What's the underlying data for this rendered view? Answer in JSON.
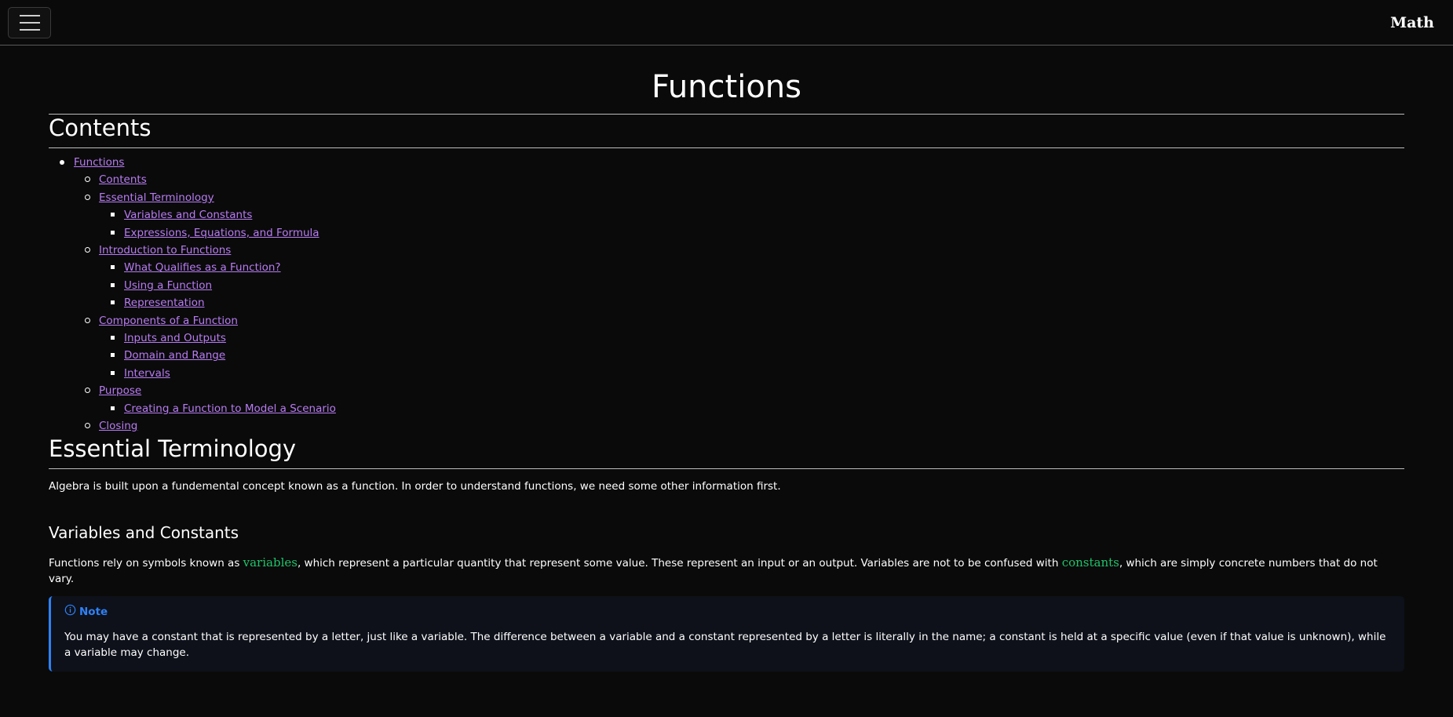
{
  "navbar": {
    "brand": "Math"
  },
  "page": {
    "title": "Functions"
  },
  "contents": {
    "heading": "Contents",
    "items": [
      {
        "label": "Functions",
        "children": [
          {
            "label": "Contents",
            "children": []
          },
          {
            "label": "Essential Terminology",
            "children": [
              {
                "label": "Variables and Constants"
              },
              {
                "label": "Expressions, Equations, and Formula"
              }
            ]
          },
          {
            "label": "Introduction to Functions",
            "children": [
              {
                "label": "What Qualifies as a Function?"
              },
              {
                "label": "Using a Function"
              },
              {
                "label": "Representation"
              }
            ]
          },
          {
            "label": "Components of a Function",
            "children": [
              {
                "label": "Inputs and Outputs"
              },
              {
                "label": "Domain and Range"
              },
              {
                "label": "Intervals"
              }
            ]
          },
          {
            "label": "Purpose",
            "children": [
              {
                "label": "Creating a Function to Model a Scenario"
              }
            ]
          },
          {
            "label": "Closing",
            "children": []
          }
        ]
      }
    ]
  },
  "essential": {
    "heading": "Essential Terminology",
    "intro": "Algebra is built upon a fundemental concept known as a function. In order to understand functions, we need some other information first."
  },
  "variables": {
    "heading": "Variables and Constants",
    "text_1": "Functions rely on symbols known as ",
    "term_1": "variables",
    "text_2": ", which represent a particular quantity that represent some value. These represent an input or an output. Variables are not to be confused with ",
    "term_2": "constants",
    "text_3": ", which are simply concrete numbers that do not vary."
  },
  "note": {
    "title": "Note",
    "icon": "info-icon",
    "color": "#2f81f7",
    "body": "You may have a constant that is represented by a letter, just like a variable. The difference between a variable and a constant represented by a letter is literally in the name; a constant is held at a specific value (even if that value is unknown), while a variable may change."
  },
  "colors": {
    "background": "#0a0a0a",
    "link": "#b87cf3",
    "term": "#1fc46b",
    "note_accent": "#2f81f7"
  }
}
